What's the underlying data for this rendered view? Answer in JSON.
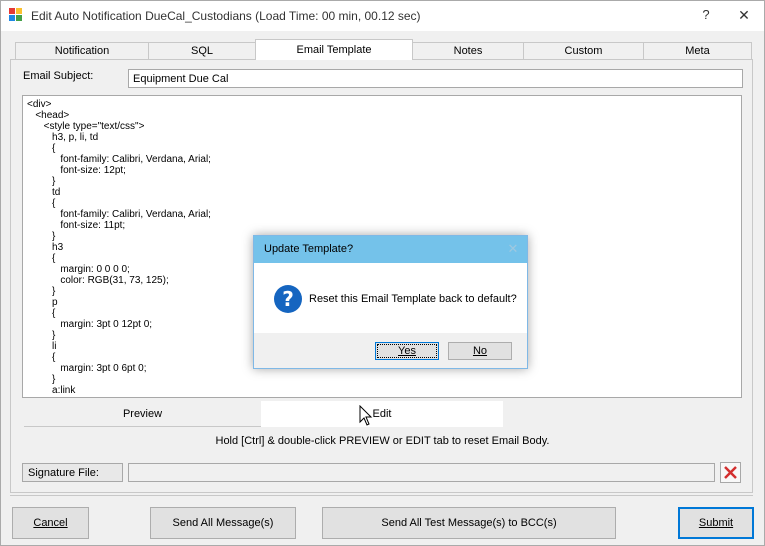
{
  "window": {
    "title": "Edit Auto Notification DueCal_Custodians (Load Time: 00 min, 00.12 sec)",
    "help": "?",
    "close": "✕"
  },
  "tabs": [
    {
      "label": "Notification",
      "active": false
    },
    {
      "label": "SQL",
      "active": false
    },
    {
      "label": "Email Template",
      "active": true
    },
    {
      "label": "Notes",
      "active": false
    },
    {
      "label": "Custom",
      "active": false
    },
    {
      "label": "Meta",
      "active": false
    }
  ],
  "email_subject": {
    "label": "Email Subject:",
    "value": "Equipment Due Cal"
  },
  "template_lines": [
    "<div>",
    "   <head>",
    "      <style type=\"text/css\">",
    "         h3, p, li, td",
    "         {",
    "            font-family: Calibri, Verdana, Arial;",
    "            font-size: 12pt;",
    "         }",
    "         td",
    "         {",
    "            font-family: Calibri, Verdana, Arial;",
    "            font-size: 11pt;",
    "         }",
    "         h3",
    "         {",
    "            margin: 0 0 0 0;",
    "            color: RGB(31, 73, 125);",
    "         }",
    "         p",
    "         {",
    "            margin: 3pt 0 12pt 0;",
    "         }",
    "         li",
    "         {",
    "            margin: 3pt 0 6pt 0;",
    "         }",
    "         a:link"
  ],
  "view_tabs": {
    "preview": "Preview",
    "edit": "Edit"
  },
  "hint": "Hold [Ctrl] & double-click PREVIEW or EDIT tab to reset Email Body.",
  "signature": {
    "label": "Signature File:",
    "value": ""
  },
  "buttons": {
    "cancel": "Cancel",
    "send_all": "Send All Message(s)",
    "send_test": "Send All Test Message(s) to BCC(s)",
    "submit": "Submit"
  },
  "dialog": {
    "title": "Update Template?",
    "close": "✕",
    "message": "Reset this Email Template back to default?",
    "yes": "Yes",
    "no": "No"
  },
  "colors": {
    "dialog_title_bg": "#74c2ea",
    "question_icon": "#1565c0",
    "focus_border": "#0078d7",
    "clear_icon": "#d32f2f"
  }
}
